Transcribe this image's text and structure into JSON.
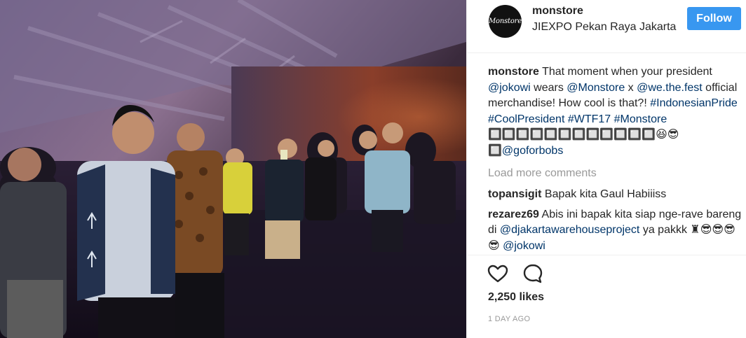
{
  "post": {
    "username": "monstore",
    "avatar_text": "Monstore",
    "location": "JIEXPO Pekan Raya Jakarta",
    "follow_label": "Follow",
    "caption": {
      "username": "monstore",
      "t1": "That moment when your president ",
      "m1": "@jokowi",
      "t2": " wears ",
      "m2": "@Monstore",
      "t3": " x ",
      "m3": "@we.the.fest",
      "t4": " official merchandise! How cool is that?! ",
      "h1": "#IndonesianPride",
      "t5": " ",
      "h2": "#CoolPresident",
      "t6": " ",
      "h3": "#WTF17",
      "t7": " ",
      "h4": "#Monstore",
      "t8": " 🔲🔲🔲🔲🔲🔲🔲🔲🔲🔲🔲🔲😆😎🔲",
      "m4": "@goforbobs"
    },
    "load_more_label": "Load more comments",
    "comments": [
      {
        "username": "topansigit",
        "text": "Bapak kita Gaul Habiiiss"
      },
      {
        "username": "rezarez69",
        "t1": "Abis ini bapak kita siap nge-rave bareng di ",
        "m1": "@djakartawarehouseproject",
        "t2": " ya pakkk ♜😎😎😎😎 ",
        "m2": "@jokowi"
      }
    ],
    "likes": "2,250 likes",
    "timestamp": "1 DAY AGO"
  },
  "colors": {
    "follow_button": "#3897f0",
    "link": "#003569",
    "muted": "#999999",
    "text": "#262626"
  },
  "icons": [
    "heart-icon",
    "comment-icon"
  ]
}
